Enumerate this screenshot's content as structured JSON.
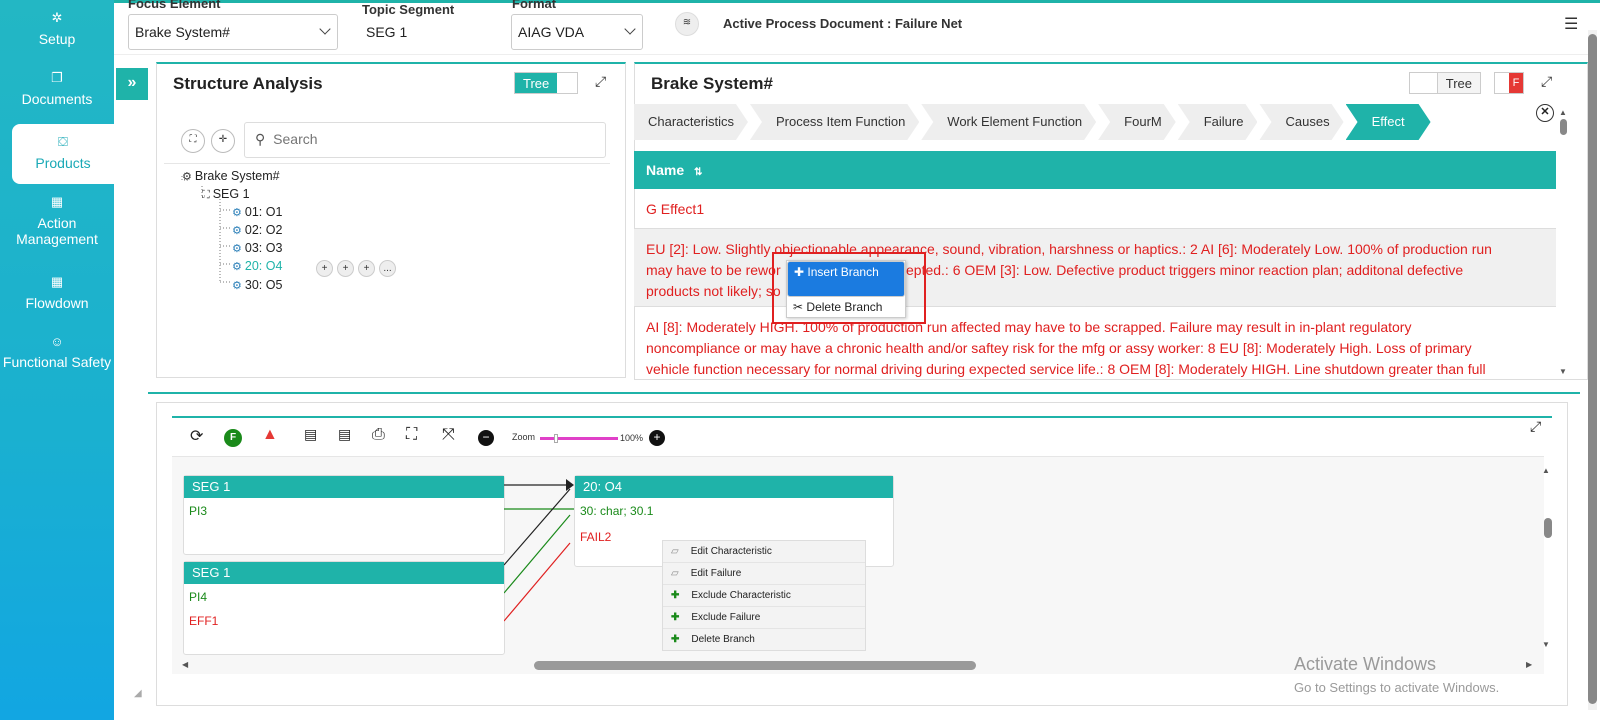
{
  "sidebar": {
    "items": [
      {
        "label": "Setup",
        "icon": "gears-icon"
      },
      {
        "label": "Documents",
        "icon": "documents-icon"
      },
      {
        "label": "Products",
        "icon": "products-icon"
      },
      {
        "label": "Action Management",
        "icon": "building-icon"
      },
      {
        "label": "Flowdown",
        "icon": "building-icon"
      },
      {
        "label": "Functional Safety",
        "icon": "safety-icon"
      }
    ]
  },
  "topbar": {
    "focus_label": "Focus Element",
    "focus_value": "Brake System#",
    "segment_label": "Topic Segment",
    "segment_value": "SEG 1",
    "format_label": "Format",
    "format_value": "AIAG VDA",
    "active_doc": "Active Process Document : Failure Net"
  },
  "structure": {
    "title": "Structure Analysis",
    "toggle_label": "Tree",
    "search_placeholder": "Search",
    "tree": [
      {
        "label": "Brake System#"
      },
      {
        "label": "SEG 1"
      },
      {
        "label": "01: O1"
      },
      {
        "label": "02: O2"
      },
      {
        "label": "03: O3"
      },
      {
        "label": "20: O4"
      },
      {
        "label": "30: O5"
      }
    ],
    "row_actions": [
      "+",
      "+",
      "+",
      "..."
    ]
  },
  "detail": {
    "title": "Brake System#",
    "toggle_label": "Tree",
    "f_badge": "F",
    "crumbs": [
      "Characteristics",
      "Process Item Function",
      "Work Element Function",
      "FourM",
      "Failure",
      "Causes",
      "Effect"
    ],
    "name_header": "Name",
    "rows": [
      "G Effect1",
      "EU [2]: Low. Slightly objectionable appearance, sound, vibration, harshness or haptics.: 2 AI [6]: Moderately Low. 100% of production run may have to be reworked, or accepted.: 6 OEM [3]: Low. Defective product triggers minor reaction plan; additonal defective products not likely; sort",
      "AI [8]: Moderately HIGH. 100% of production run affected may have to be scrapped. Failure may result in in-plant regulatory noncompliance or may have a chronic health and/or saftey risk for the mfg or assy worker: 8 EU [8]: Moderately High. Loss of primary vehicle function necessary for normal driving during expected service life.: 8 OEM [8]: Moderately HIGH. Line shutdown greater than full"
    ],
    "row2_lines": [
      "EU [2]: Low. Slightly objectionable appearance, sound, vibration, harshness or haptics.: 2 AI [6]: Moderately Low. 100% of production run",
      "may have to be rewor",
      "ccepted.: 6 OEM [3]: Low. Defective product triggers minor reaction plan; additonal defective",
      "products not likely; so"
    ],
    "row3_lines": [
      "AI [8]: Moderately HIGH. 100% of production run affected may have to be scrapped. Failure may result in in-plant regulatory",
      "noncompliance or may have a chronic health and/or saftey risk for the mfg or assy worker: 8 EU [8]: Moderately High. Loss of primary",
      "vehicle function necessary for normal driving during expected service life.: 8 OEM [8]: Moderately HIGH. Line shutdown greater than full"
    ],
    "context_menu": [
      "Insert Branch",
      "Delete Branch"
    ]
  },
  "graph": {
    "zoom_label": "Zoom",
    "zoom_value": "100%",
    "node1": {
      "title": "SEG 1",
      "line1": "PI3"
    },
    "node2": {
      "title": "SEG 1",
      "line1": "PI4",
      "line2": "EFF1"
    },
    "node3": {
      "title": "20: O4",
      "line1": "30: char; 30.1",
      "line2": "FAIL2"
    },
    "context_menu": [
      "Edit Characteristic",
      "Edit Failure",
      "Exclude Characteristic",
      "Exclude Failure",
      "Delete Branch"
    ]
  },
  "watermark": {
    "line1": "Activate Windows",
    "line2": "Go to Settings to activate Windows."
  },
  "colors": {
    "accent": "#1fb3a9",
    "sidebar": "#1ab0d0",
    "error_red": "#e02020",
    "green": "#1a8a1a",
    "menu_select": "#1b7be0"
  }
}
